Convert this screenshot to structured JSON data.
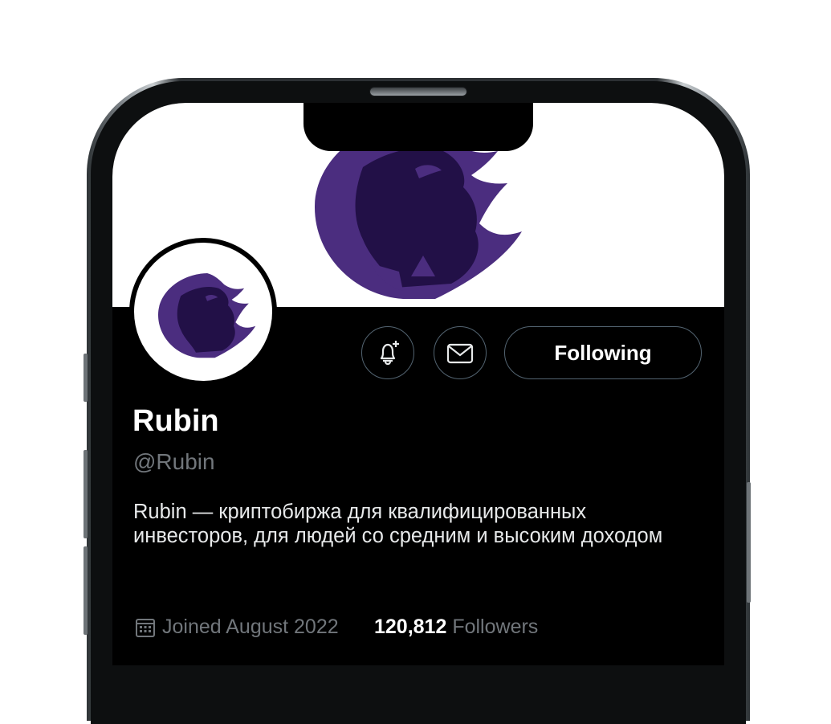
{
  "profile": {
    "name": "Rubin",
    "handle": "@Rubin",
    "bio": "Rubin — криптобиржа для квалифицированных инвесторов, для людей со средним и высоким доходом",
    "joined": "Joined August 2022",
    "followers_count": "120,812",
    "followers_label": "Followers"
  },
  "actions": {
    "following_label": "Following"
  },
  "icons": {
    "notify": "bell-plus-icon",
    "message": "envelope-icon",
    "joined": "calendar-icon",
    "logo": "eagle-logo"
  },
  "colors": {
    "brand_purple": "#4b2d7f",
    "brand_dark": "#221047",
    "background": "#000000",
    "muted_text": "#71767b",
    "border": "#536471"
  }
}
